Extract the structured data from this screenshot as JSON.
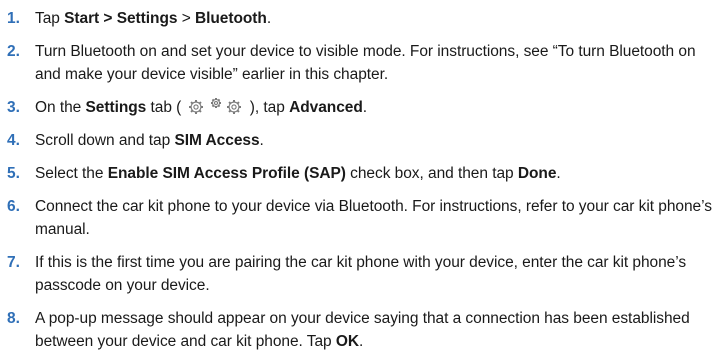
{
  "steps": [
    {
      "number": "1.",
      "parts": [
        {
          "text": "Tap ",
          "bold": false
        },
        {
          "text": "Start > Settings",
          "bold": true
        },
        {
          "text": " > ",
          "bold": false
        },
        {
          "text": "Bluetooth",
          "bold": true
        },
        {
          "text": ".",
          "bold": false
        }
      ]
    },
    {
      "number": "2.",
      "parts": [
        {
          "text": "Turn Bluetooth on and set your device to visible mode. For instructions, see “To turn Bluetooth on and make your device visible” earlier in this chapter.",
          "bold": false
        }
      ]
    },
    {
      "number": "3.",
      "parts": [
        {
          "text": "On the ",
          "bold": false
        },
        {
          "text": "Settings",
          "bold": true
        },
        {
          "text": " tab ( ",
          "bold": false
        },
        {
          "icon": "settings-gears-icon"
        },
        {
          "text": " ), tap ",
          "bold": false
        },
        {
          "text": "Advanced",
          "bold": true
        },
        {
          "text": ".",
          "bold": false
        }
      ]
    },
    {
      "number": "4.",
      "parts": [
        {
          "text": "Scroll down and tap ",
          "bold": false
        },
        {
          "text": "SIM Access",
          "bold": true
        },
        {
          "text": ".",
          "bold": false
        }
      ]
    },
    {
      "number": "5.",
      "parts": [
        {
          "text": "Select the ",
          "bold": false
        },
        {
          "text": "Enable SIM Access Profile (SAP)",
          "bold": true
        },
        {
          "text": " check box, and then tap ",
          "bold": false
        },
        {
          "text": "Done",
          "bold": true
        },
        {
          "text": ".",
          "bold": false
        }
      ]
    },
    {
      "number": "6.",
      "parts": [
        {
          "text": "Connect the car kit phone to your device via Bluetooth. For instructions, refer to your car kit phone’s manual.",
          "bold": false
        }
      ]
    },
    {
      "number": "7.",
      "parts": [
        {
          "text": "If this is the first time you are pairing the car kit phone with your device, enter the car kit phone’s passcode on your device.",
          "bold": false
        }
      ]
    },
    {
      "number": "8.",
      "parts": [
        {
          "text": "A pop-up message should appear on your device saying that a connection has been established between your device and car kit phone. Tap ",
          "bold": false
        },
        {
          "text": "OK",
          "bold": true
        },
        {
          "text": ".",
          "bold": false
        }
      ]
    }
  ],
  "colors": {
    "step_number": "#2f6fb7",
    "text": "#1a1a1a",
    "icon_stroke": "#7a7a7a"
  }
}
